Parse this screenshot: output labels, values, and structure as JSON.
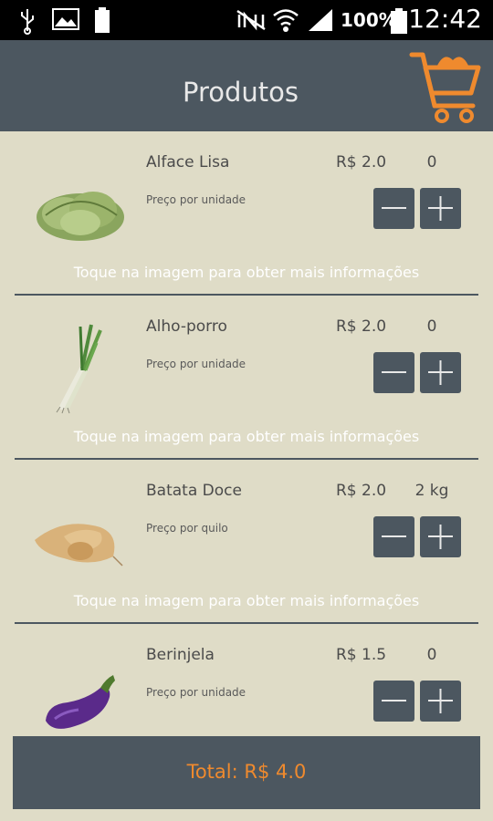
{
  "status_bar": {
    "battery_percent": "100%",
    "time": "12:42"
  },
  "header": {
    "title": "Produtos"
  },
  "products": [
    {
      "name": "Alface Lisa",
      "price": "R$ 2.0",
      "quantity": "0",
      "unit": "Preço por unidade",
      "hint": "Toque na imagem para obter mais informações"
    },
    {
      "name": "Alho-porro",
      "price": "R$ 2.0",
      "quantity": "0",
      "unit": "Preço por unidade",
      "hint": "Toque na imagem para obter mais informações"
    },
    {
      "name": "Batata Doce",
      "price": "R$ 2.0",
      "quantity": "2 kg",
      "unit": "Preço por quilo",
      "hint": "Toque na imagem para obter mais informações"
    },
    {
      "name": "Berinjela",
      "price": "R$ 1.5",
      "quantity": "0",
      "unit": "Preço por unidade"
    }
  ],
  "footer": {
    "total": "Total: R$ 4.0"
  },
  "colors": {
    "background": "#dfdcc7",
    "app_bar": "#4c5760",
    "accent": "#ef8a2e",
    "text": "#4b4b4b"
  },
  "icons": {
    "cart": "shopping-cart-icon",
    "minus": "minus-icon",
    "plus": "plus-icon"
  }
}
